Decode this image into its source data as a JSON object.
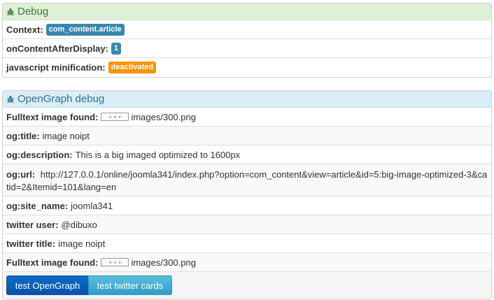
{
  "colors": {
    "success_bg": "#dff0d8",
    "success_text": "#3c763d",
    "info_bg": "#d9edf7",
    "info_text": "#31708f",
    "label_blue": "#3a87ad",
    "label_orange": "#f89406",
    "btn_primary": "#0a5cb8",
    "btn_info": "#49b0d6"
  },
  "debug": {
    "title": "Debug",
    "icon": "bug-icon",
    "context_label": "Context:",
    "context_value": "com_content.article",
    "oncontent_label": "onContentAfterDisplay:",
    "oncontent_value": "1",
    "minification_label": "javascript minification:",
    "minification_value": "deactivated"
  },
  "og": {
    "title": "OpenGraph debug",
    "icon": "bug-icon",
    "fulltext_label": "Fulltext image found:",
    "fulltext_value": "images/300.png",
    "og_title_label": "og:title:",
    "og_title_value": "image noipt",
    "og_description_label": "og:description:",
    "og_description_value": "This is a big imaged optimized to 1600px",
    "og_url_label": "og:url:",
    "og_url_value": "http://127.0.0.1/online/joomla341/index.php?option=com_content&view=article&id=5:big-image-optimized-3&catid=2&Itemid=101&lang=en",
    "og_site_name_label": "og:site_name:",
    "og_site_name_value": "joomla341",
    "twitter_user_label": "twitter user:",
    "twitter_user_value": "@dibuxo",
    "twitter_title_label": "twitter title:",
    "twitter_title_value": "image noipt",
    "fulltext2_label": "Fulltext image found:",
    "fulltext2_value": "images/300.png",
    "btn_og": "test OpenGraph",
    "btn_twitter": "test twitter cards"
  }
}
